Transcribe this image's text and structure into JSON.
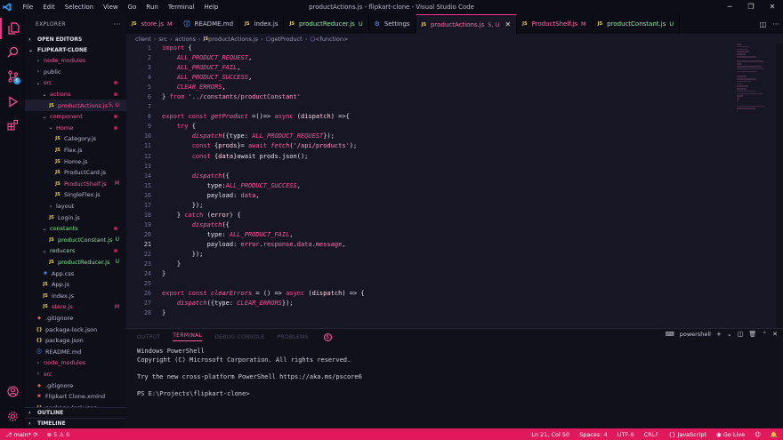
{
  "window": {
    "title": "productActions.js - flipkart-clone - Visual Studio Code",
    "menu": [
      "File",
      "Edit",
      "Selection",
      "View",
      "Go",
      "Run",
      "Terminal",
      "Help"
    ]
  },
  "sidebar": {
    "header": "EXPLORER",
    "open_editors": "OPEN EDITORS",
    "project": "FLIPKART-CLONE",
    "tree": [
      {
        "label": "node_modules",
        "depth": 1,
        "type": "folder",
        "open": false,
        "color": "pink"
      },
      {
        "label": "public",
        "depth": 1,
        "type": "folder",
        "open": false,
        "color": "plain"
      },
      {
        "label": "src",
        "depth": 1,
        "type": "folder",
        "open": true,
        "color": "pink",
        "dot": true
      },
      {
        "label": "actions",
        "depth": 2,
        "type": "folder",
        "open": true,
        "color": "pink",
        "dot": true
      },
      {
        "label": "productActions.js",
        "depth": 3,
        "type": "js",
        "color": "pink",
        "status": "5, U",
        "selected": true
      },
      {
        "label": "component",
        "depth": 2,
        "type": "folder",
        "open": true,
        "color": "pink",
        "dot": true
      },
      {
        "label": "Home",
        "depth": 3,
        "type": "folder",
        "open": true,
        "color": "pink",
        "dot": true
      },
      {
        "label": "Category.js",
        "depth": 4,
        "type": "js",
        "color": "plain"
      },
      {
        "label": "Flex.js",
        "depth": 4,
        "type": "js",
        "color": "plain"
      },
      {
        "label": "Home.js",
        "depth": 4,
        "type": "js",
        "color": "plain"
      },
      {
        "label": "ProductCard.js",
        "depth": 4,
        "type": "js",
        "color": "plain"
      },
      {
        "label": "ProductShelf.js",
        "depth": 4,
        "type": "js",
        "color": "pink",
        "status": "M"
      },
      {
        "label": "SingleFlex.js",
        "depth": 4,
        "type": "js",
        "color": "plain"
      },
      {
        "label": "layout",
        "depth": 3,
        "type": "folder",
        "open": false,
        "color": "plain"
      },
      {
        "label": "Login.js",
        "depth": 3,
        "type": "js",
        "color": "plain"
      },
      {
        "label": "constants",
        "depth": 2,
        "type": "folder",
        "open": true,
        "color": "green",
        "dot": true
      },
      {
        "label": "productConstant.js",
        "depth": 3,
        "type": "js",
        "color": "green",
        "status": "U"
      },
      {
        "label": "reducers",
        "depth": 2,
        "type": "folder",
        "open": true,
        "color": "green",
        "dot": true
      },
      {
        "label": "productReducer.js",
        "depth": 3,
        "type": "js",
        "color": "green",
        "status": "U"
      },
      {
        "label": "App.css",
        "depth": 2,
        "type": "css",
        "color": "plain"
      },
      {
        "label": "App.js",
        "depth": 2,
        "type": "js",
        "color": "plain"
      },
      {
        "label": "index.js",
        "depth": 2,
        "type": "js",
        "color": "plain"
      },
      {
        "label": "store.js",
        "depth": 2,
        "type": "js",
        "color": "pink",
        "status": "M"
      },
      {
        "label": ".gitignore",
        "depth": 1,
        "type": "git",
        "color": "plain"
      },
      {
        "label": "package-lock.json",
        "depth": 1,
        "type": "json",
        "color": "plain"
      },
      {
        "label": "package.json",
        "depth": 1,
        "type": "json",
        "color": "plain"
      },
      {
        "label": "README.md",
        "depth": 1,
        "type": "md",
        "color": "plain"
      },
      {
        "label": "node_modules",
        "depth": 1,
        "type": "folder",
        "open": false,
        "color": "pink"
      },
      {
        "label": "src",
        "depth": 1,
        "type": "folder",
        "open": false,
        "color": "pink"
      },
      {
        "label": ".gitignore",
        "depth": 1,
        "type": "git",
        "color": "plain"
      },
      {
        "label": "Flipkart Clone.xmind",
        "depth": 1,
        "type": "xmind",
        "color": "plain"
      },
      {
        "label": "package-lock.json",
        "depth": 1,
        "type": "json",
        "color": "plain"
      }
    ],
    "outline": "OUTLINE",
    "timeline": "TIMELINE"
  },
  "tabs": [
    {
      "label": "store.js",
      "status": "M",
      "icon": "js",
      "active": false
    },
    {
      "label": "README.md",
      "status": "",
      "icon": "info",
      "active": false
    },
    {
      "label": "index.js",
      "status": "",
      "icon": "js",
      "active": false
    },
    {
      "label": "productReducer.js",
      "status": "U",
      "icon": "js",
      "active": false
    },
    {
      "label": "Settings",
      "status": "",
      "icon": "settings",
      "active": false
    },
    {
      "label": "productActions.js",
      "status": "5, U",
      "icon": "js",
      "active": true
    },
    {
      "label": "ProductShelf.js",
      "status": "M",
      "icon": "js",
      "active": false
    },
    {
      "label": "productConstant.js",
      "status": "U",
      "icon": "js",
      "active": false
    }
  ],
  "breadcrumb": [
    "client",
    "src",
    "actions",
    "productActions.js",
    "getProduct",
    "<function>"
  ],
  "editor": {
    "line_numbers": [
      "1",
      "2",
      "3",
      "4",
      "5",
      "6",
      "7",
      "8",
      "9",
      "10",
      "11",
      "12",
      "13",
      "14",
      "15",
      "16",
      "17",
      "18",
      "19",
      "20",
      "21",
      "22",
      "23",
      "24",
      "25",
      "26",
      "27",
      "28"
    ],
    "current_line": "21",
    "code": [
      [
        [
          "kw",
          "import"
        ],
        [
          "punc",
          " {"
        ]
      ],
      [
        [
          "const",
          "    ALL_PRODUCT_REQUEST"
        ],
        [
          "punc",
          ","
        ]
      ],
      [
        [
          "const",
          "    ALL_PRODUCT_FAIL"
        ],
        [
          "punc",
          ","
        ]
      ],
      [
        [
          "const",
          "    ALL_PRODUCT_SUCCESS"
        ],
        [
          "punc",
          ","
        ]
      ],
      [
        [
          "const",
          "    CLEAR_ERRORS"
        ],
        [
          "punc",
          ","
        ]
      ],
      [
        [
          "punc",
          "} "
        ],
        [
          "kw",
          "from"
        ],
        [
          "str",
          " '../constants/productConstant'"
        ]
      ],
      [],
      [
        [
          "kw",
          "export"
        ],
        [
          "kw",
          " const "
        ],
        [
          "fn",
          "getProduct"
        ],
        [
          "punc",
          " =()=> "
        ],
        [
          "kw",
          "async"
        ],
        [
          "punc",
          " ("
        ],
        [
          "pl",
          "dispatch"
        ],
        [
          "punc",
          ") =>{"
        ]
      ],
      [
        [
          "kw",
          "    try"
        ],
        [
          "punc",
          " {"
        ]
      ],
      [
        [
          "fn",
          "        dispatch"
        ],
        [
          "punc",
          "({type: "
        ],
        [
          "const",
          "ALL_PRODUCT_REQUEST"
        ],
        [
          "punc",
          "});"
        ]
      ],
      [
        [
          "kw",
          "        const"
        ],
        [
          "punc",
          " {"
        ],
        [
          "pl",
          "prods"
        ],
        [
          "punc",
          "}= "
        ],
        [
          "kw",
          "await "
        ],
        [
          "fn",
          "fetch"
        ],
        [
          "punc",
          "("
        ],
        [
          "str",
          "'/api/products'"
        ],
        [
          "punc",
          ");"
        ]
      ],
      [
        [
          "kw",
          "        const"
        ],
        [
          "punc",
          " {"
        ],
        [
          "pl",
          "data"
        ],
        [
          "punc",
          "}await prods.json();"
        ]
      ],
      [],
      [
        [
          "fn",
          "        dispatch"
        ],
        [
          "punc",
          "({"
        ]
      ],
      [
        [
          "punc",
          "            type:"
        ],
        [
          "const",
          "ALL_PRODUCT_SUCCESS"
        ],
        [
          "punc",
          ","
        ]
      ],
      [
        [
          "punc",
          "            payload: "
        ],
        [
          "prop",
          "data"
        ],
        [
          "punc",
          ","
        ]
      ],
      [
        [
          "punc",
          "        });"
        ]
      ],
      [
        [
          "punc",
          "    } "
        ],
        [
          "kw",
          "catch"
        ],
        [
          "punc",
          " ("
        ],
        [
          "pl",
          "error"
        ],
        [
          "punc",
          ") {"
        ]
      ],
      [
        [
          "fn",
          "        dispatch"
        ],
        [
          "punc",
          "({"
        ]
      ],
      [
        [
          "punc",
          "            type: "
        ],
        [
          "const",
          "ALL_PRODUCT_FAIL"
        ],
        [
          "punc",
          ","
        ]
      ],
      [
        [
          "punc",
          "            payload: "
        ],
        [
          "prop",
          "error"
        ],
        [
          "punc",
          "."
        ],
        [
          "prop",
          "response"
        ],
        [
          "punc",
          "."
        ],
        [
          "prop",
          "data"
        ],
        [
          "punc",
          "."
        ],
        [
          "prop",
          "message"
        ],
        [
          "punc",
          ","
        ]
      ],
      [
        [
          "punc",
          "        });"
        ]
      ],
      [
        [
          "punc",
          "    }"
        ]
      ],
      [
        [
          "punc",
          "}"
        ]
      ],
      [],
      [
        [
          "kw",
          "export"
        ],
        [
          "kw",
          " const "
        ],
        [
          "fn",
          "clearErrors"
        ],
        [
          "punc",
          " = () => "
        ],
        [
          "kw",
          "async"
        ],
        [
          "punc",
          " ("
        ],
        [
          "pl",
          "dispatch"
        ],
        [
          "punc",
          ") => {"
        ]
      ],
      [
        [
          "fn",
          "    dispatch"
        ],
        [
          "punc",
          "({type: "
        ],
        [
          "const",
          "CLEAR_ERRORS"
        ],
        [
          "punc",
          "});"
        ]
      ],
      [
        [
          "punc",
          "}"
        ]
      ]
    ]
  },
  "panel": {
    "tabs": [
      "OUTPUT",
      "TERMINAL",
      "DEBUG CONSOLE",
      "PROBLEMS"
    ],
    "active_tab": "TERMINAL",
    "problems_count": "5",
    "shell": "powershell",
    "terminal_lines": [
      "Windows PowerShell",
      "Copyright (C) Microsoft Corporation. All rights reserved.",
      "",
      "Try the new cross-platform PowerShell https://aka.ms/pscore6",
      "",
      "PS E:\\Projects\\flipkart-clone> "
    ]
  },
  "status": {
    "branch": "main*",
    "errors": "5",
    "warnings": "0",
    "position": "Ln 21, Col 50",
    "spaces": "Spaces: 4",
    "encoding": "UTF-8",
    "eol": "CRLF",
    "language": "JavaScript",
    "golive": "Go Live"
  },
  "colors": {
    "accent": "#ff2e88",
    "statusbar": "#e0185c",
    "modified": "#ff4f96",
    "untracked": "#7fe58f"
  }
}
